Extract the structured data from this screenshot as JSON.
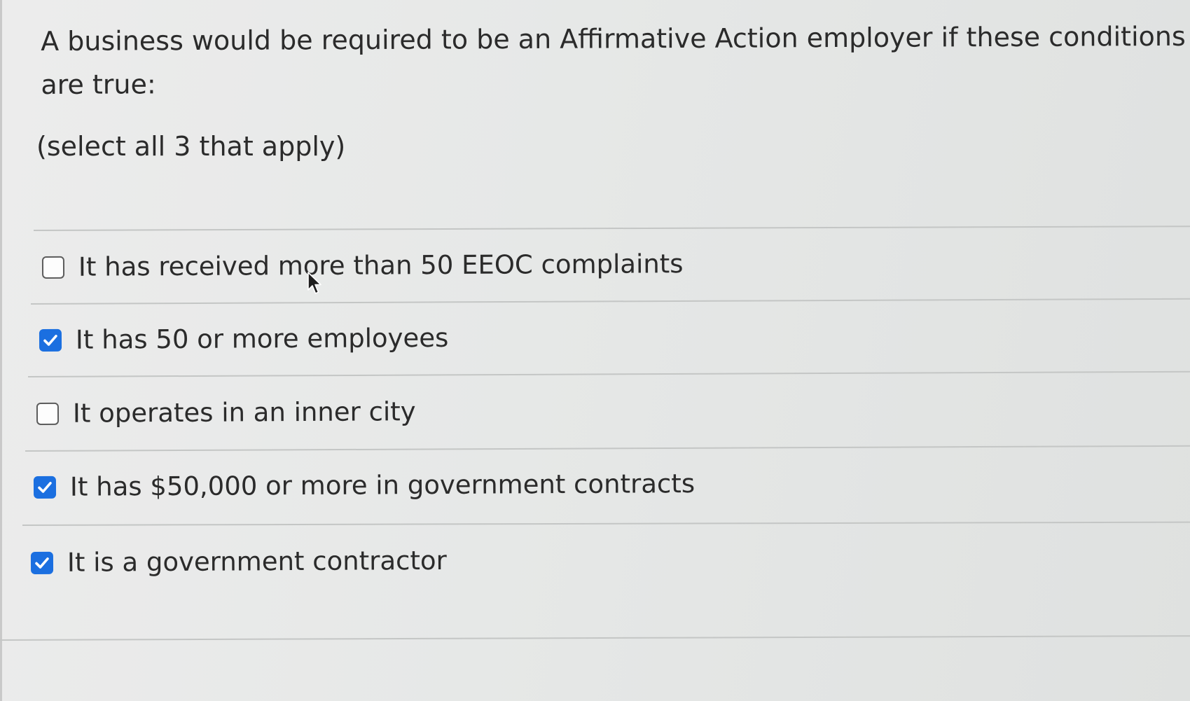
{
  "question": {
    "text": "A business would be required to be an Affirmative Action employer if these conditions are true:",
    "instruction": "(select all 3 that apply)"
  },
  "options": [
    {
      "label": "It has received more than 50 EEOC complaints",
      "checked": false
    },
    {
      "label": "It has 50 or more employees",
      "checked": true
    },
    {
      "label": "It operates in an inner city",
      "checked": false
    },
    {
      "label": "It has $50,000 or more in government contracts",
      "checked": true
    },
    {
      "label": "It is a government contractor",
      "checked": true
    }
  ],
  "colors": {
    "checkbox_checked": "#1b6fe0",
    "checkbox_border": "#5c5c5c",
    "text": "#2b2b2b",
    "background": "#e6e8e7",
    "divider": "#c4c6c5"
  },
  "icons": {
    "checkmark": "checkmark-icon",
    "cursor": "mouse-pointer-icon"
  }
}
